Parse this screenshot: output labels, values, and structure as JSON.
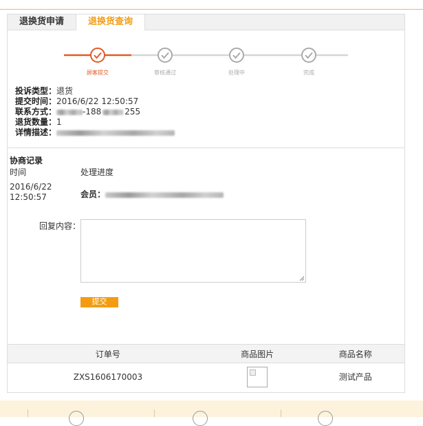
{
  "tabs": [
    {
      "label": "退换货申请",
      "active": false
    },
    {
      "label": "退换货查询",
      "active": true
    }
  ],
  "progress": {
    "steps": [
      "顾客提交",
      "审核通过",
      "处理中",
      "完成"
    ],
    "current_step": 1,
    "colors": {
      "active": "#e15a27",
      "inactive": "#c8c8c8"
    }
  },
  "complaint": {
    "type_label": "投诉类型：",
    "type_value": "退货",
    "submit_time_label": "提交时间：",
    "submit_time_value": "2016/6/22 12:50:57",
    "contact_label": "联系方式：",
    "contact_value_mid": "-188",
    "contact_value_end": "255",
    "quantity_label": "退货数量：",
    "quantity_value": "1",
    "detail_label": "详情描述："
  },
  "negotiation": {
    "title": "协商记录",
    "col_time": "时间",
    "col_progress": "处理进度",
    "record_time": "2016/6/22 12:50:57",
    "member_label": "会员："
  },
  "reply": {
    "label": "回复内容：",
    "value": "",
    "submit_label": "提交"
  },
  "order_table": {
    "headers": [
      "订单号",
      "商品图片",
      "商品名称"
    ],
    "rows": [
      {
        "order_no": "ZXS1606170003",
        "product_name": "测试产品"
      }
    ]
  },
  "colors": {
    "accent": "#f39c12",
    "progress_active": "#e15a27",
    "footer_bg": "#fdf2dc"
  }
}
